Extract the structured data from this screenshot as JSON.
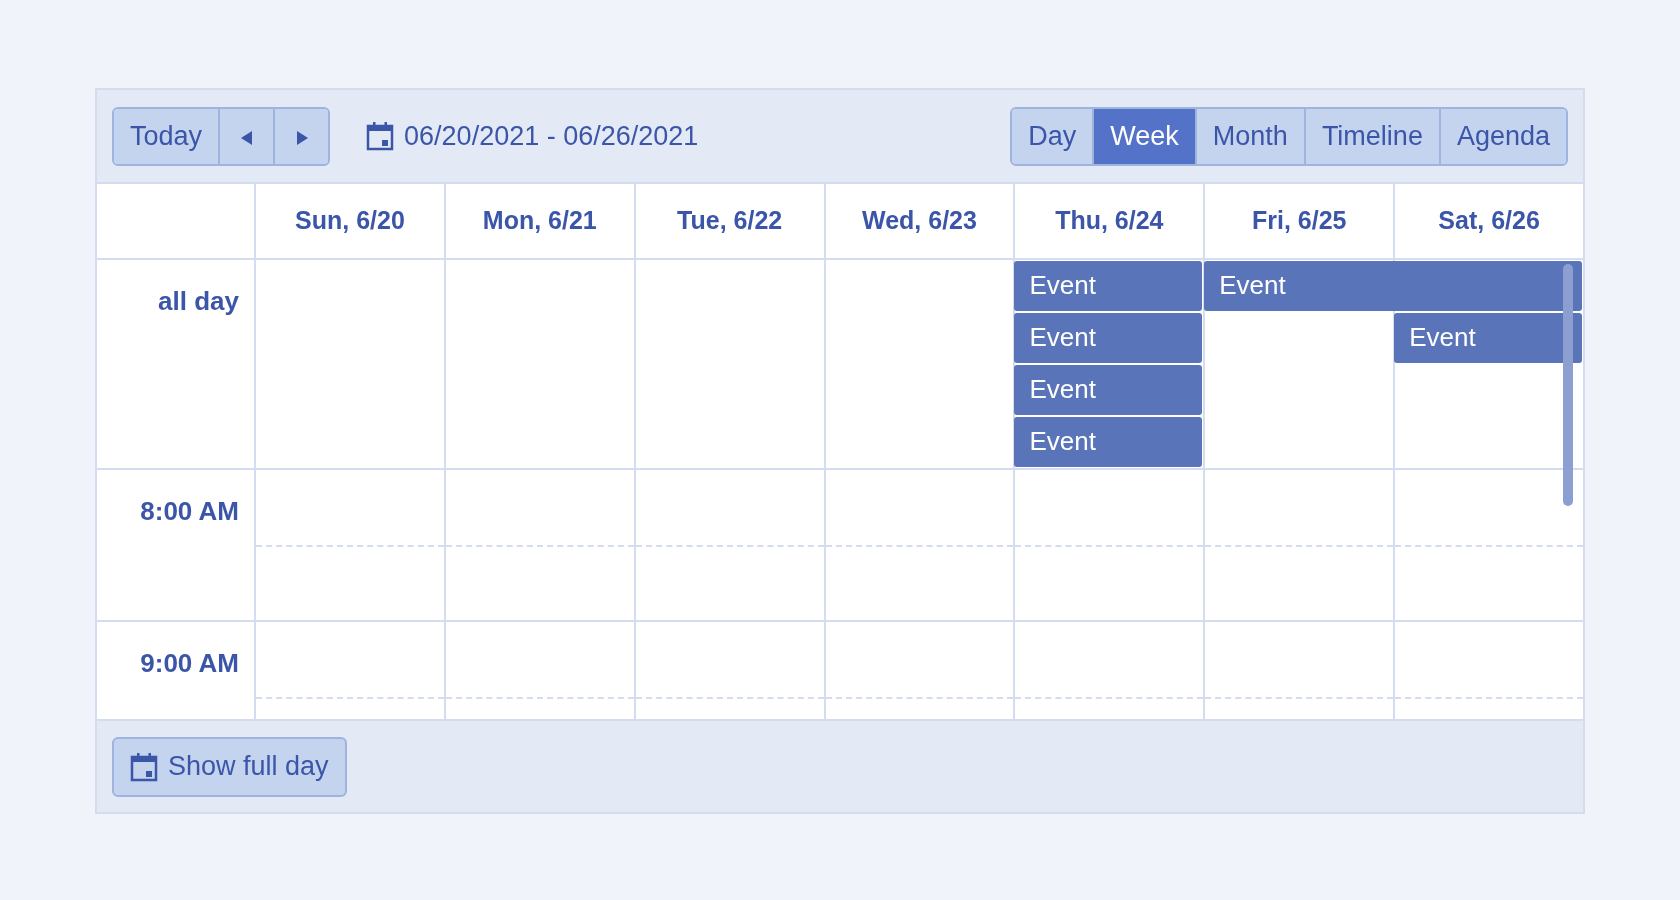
{
  "toolbar": {
    "today_button": "Today",
    "date_range": "06/20/2021 - 06/26/2021",
    "views": [
      {
        "label": "Day",
        "selected": false
      },
      {
        "label": "Week",
        "selected": true
      },
      {
        "label": "Month",
        "selected": false
      },
      {
        "label": "Timeline",
        "selected": false
      },
      {
        "label": "Agenda",
        "selected": false
      }
    ]
  },
  "days": [
    "Sun, 6/20",
    "Mon, 6/21",
    "Tue, 6/22",
    "Wed, 6/23",
    "Thu, 6/24",
    "Fri, 6/25",
    "Sat, 6/26"
  ],
  "all_day_label": "all day",
  "all_day_events": [
    {
      "title": "Event"
    },
    {
      "title": "Event"
    },
    {
      "title": "Event"
    },
    {
      "title": "Event"
    },
    {
      "title": "Event"
    },
    {
      "title": "Event"
    }
  ],
  "time_slots": [
    "8:00 AM",
    "9:00 AM"
  ],
  "footer": {
    "button": "Show full day"
  }
}
